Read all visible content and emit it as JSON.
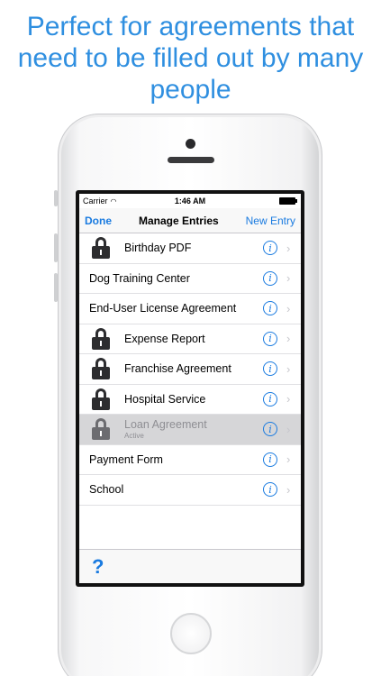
{
  "headline": "Perfect for agreements that need to be filled out by many people",
  "status": {
    "carrier": "Carrier",
    "time": "1:46 AM"
  },
  "nav": {
    "left": "Done",
    "title": "Manage Entries",
    "right": "New Entry"
  },
  "entries": [
    {
      "label": "Birthday PDF",
      "locked": true
    },
    {
      "label": "Dog Training Center",
      "locked": false
    },
    {
      "label": "End-User License Agreement",
      "locked": false
    },
    {
      "label": "Expense Report",
      "locked": true
    },
    {
      "label": "Franchise Agreement",
      "locked": true
    },
    {
      "label": "Hospital Service",
      "locked": true
    },
    {
      "label": "Loan Agreement",
      "subtitle": "Active",
      "locked": true,
      "active": true
    },
    {
      "label": "Payment Form",
      "locked": false
    },
    {
      "label": "School",
      "locked": false
    }
  ],
  "toolbar": {
    "help": "?"
  },
  "colors": {
    "accent": "#1a7be0",
    "headline": "#2f8fe0",
    "active_row": "#d6d6d8"
  }
}
